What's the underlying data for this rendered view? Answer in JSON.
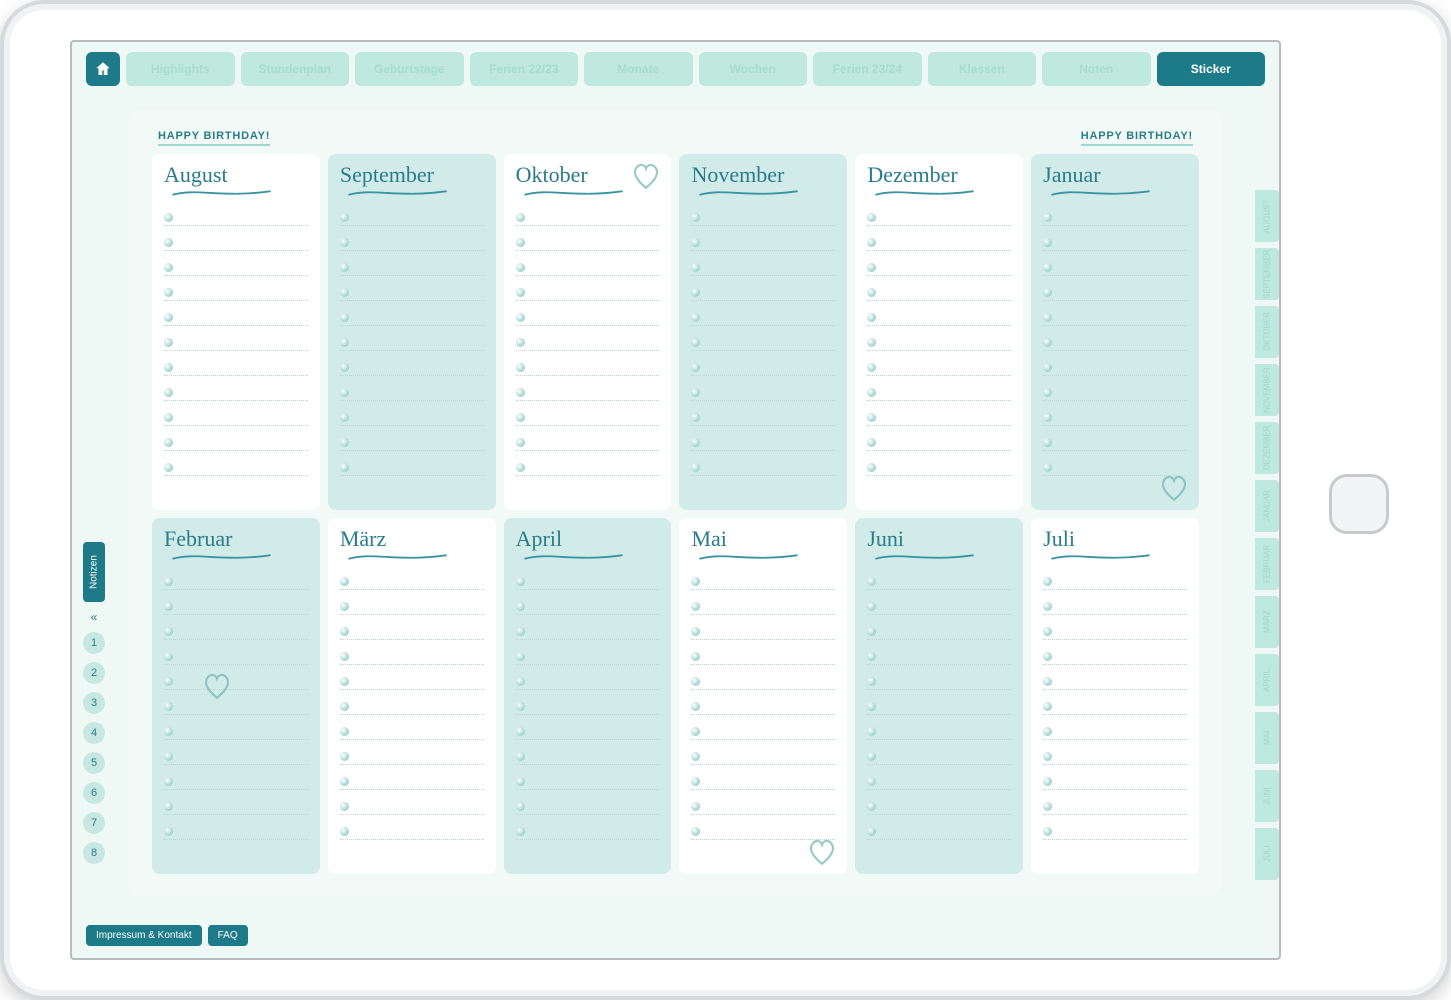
{
  "nav": {
    "tabs": [
      {
        "label": "Highlights"
      },
      {
        "label": "Stundenplan"
      },
      {
        "label": "Geburtstage"
      },
      {
        "label": "Ferien 22/23"
      },
      {
        "label": "Monate"
      },
      {
        "label": "Wochen"
      },
      {
        "label": "Ferien 23/24"
      },
      {
        "label": "Klassen"
      },
      {
        "label": "Noten"
      },
      {
        "label": "Sticker"
      }
    ],
    "active_index": 9
  },
  "page": {
    "title_left": "HAPPY BIRTHDAY!",
    "title_right": "HAPPY BIRTHDAY!"
  },
  "lines_per_card": 11,
  "months": [
    {
      "name": "August",
      "tint": false,
      "heart": null
    },
    {
      "name": "September",
      "tint": true,
      "heart": null
    },
    {
      "name": "Oktober",
      "tint": false,
      "heart": "top-right"
    },
    {
      "name": "November",
      "tint": true,
      "heart": null
    },
    {
      "name": "Dezember",
      "tint": false,
      "heart": null
    },
    {
      "name": "Januar",
      "tint": true,
      "heart": "bottom-right"
    },
    {
      "name": "Februar",
      "tint": true,
      "heart": "mid-left"
    },
    {
      "name": "März",
      "tint": false,
      "heart": null
    },
    {
      "name": "April",
      "tint": true,
      "heart": null
    },
    {
      "name": "Mai",
      "tint": false,
      "heart": "bottom-right"
    },
    {
      "name": "Juni",
      "tint": true,
      "heart": null
    },
    {
      "name": "Juli",
      "tint": false,
      "heart": null
    }
  ],
  "left_rail": {
    "label": "Notizen",
    "chevron": "«",
    "items": [
      "1",
      "2",
      "3",
      "4",
      "5",
      "6",
      "7",
      "8"
    ]
  },
  "right_rail": {
    "items": [
      "AUGUST",
      "SEPTEMBER",
      "OKTOBER",
      "NOVEMBER",
      "DEZEMBER",
      "JANUAR",
      "FEBRUAR",
      "MÄRZ",
      "APRIL",
      "MAI",
      "JUNI",
      "JULI"
    ]
  },
  "footer": {
    "impressum": "Impressum & Kontakt",
    "faq": "FAQ"
  }
}
